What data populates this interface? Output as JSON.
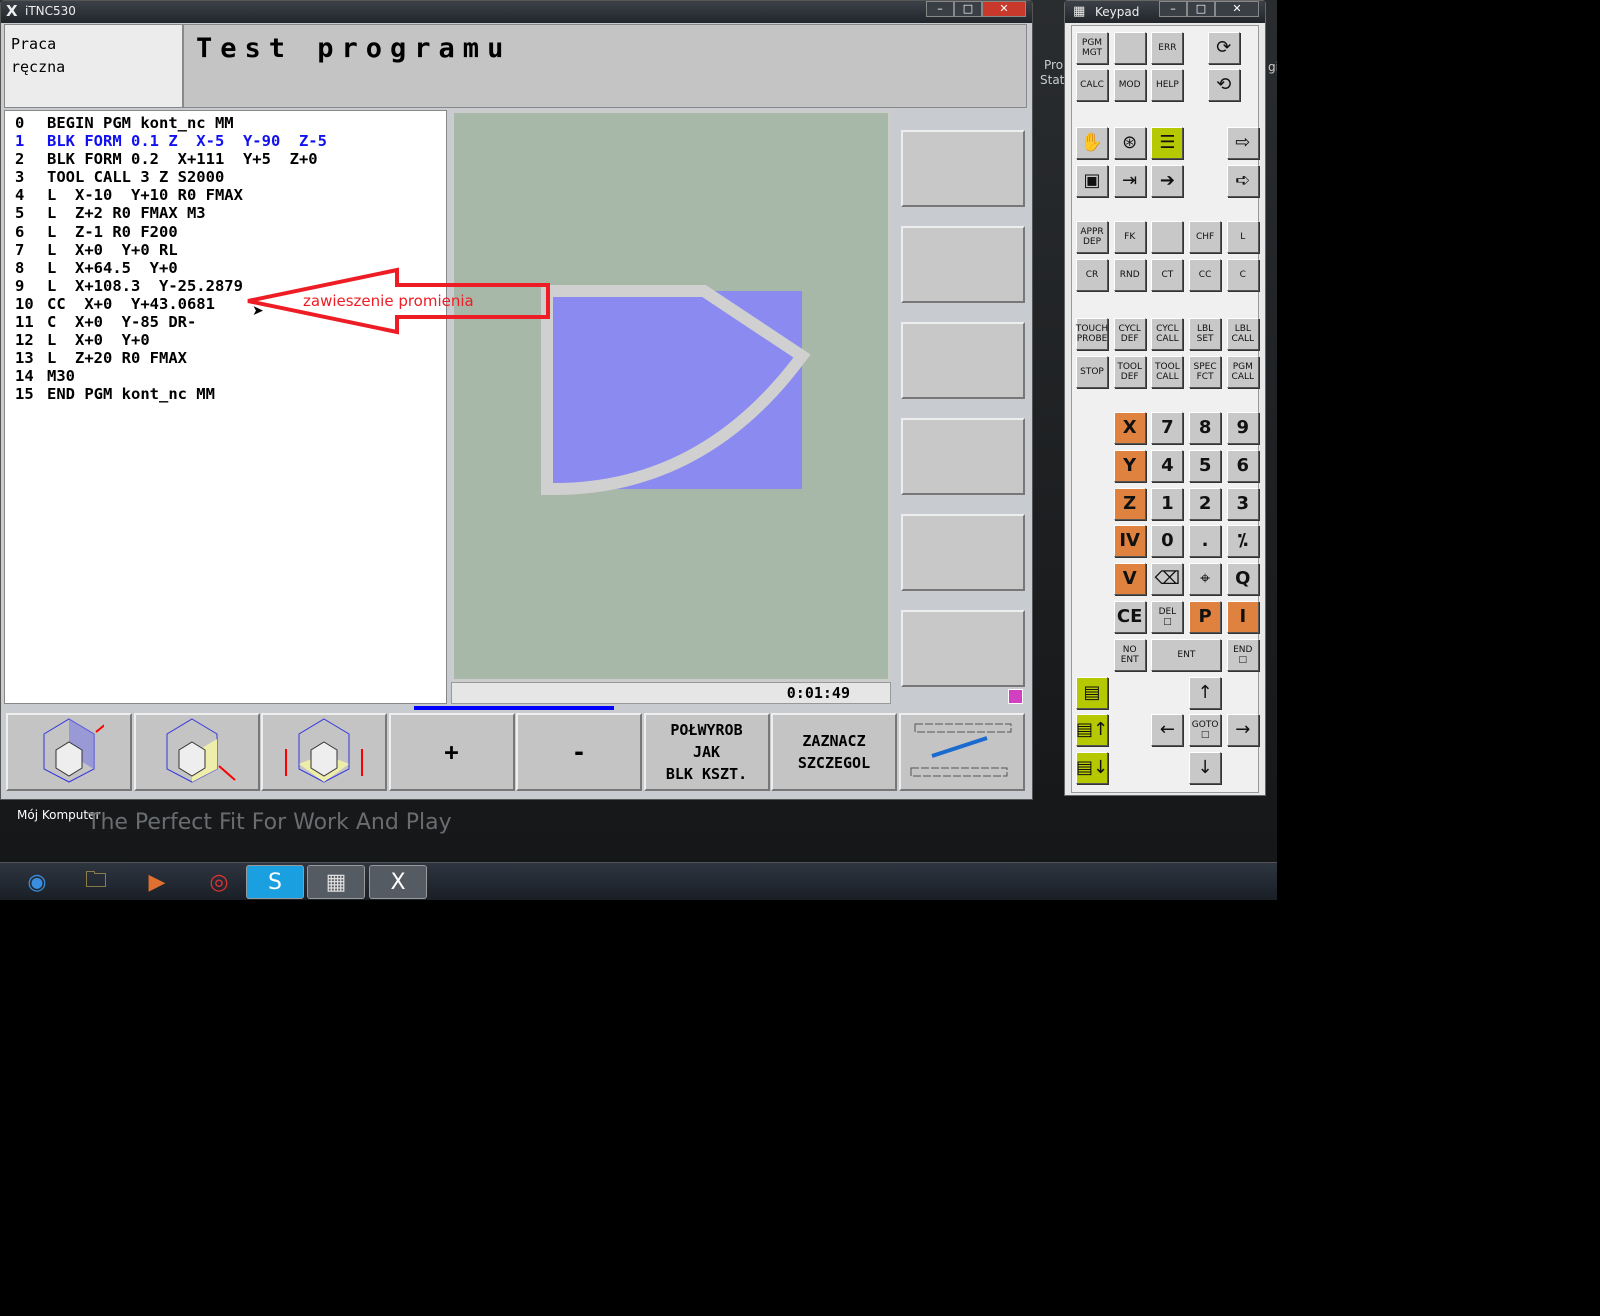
{
  "window": {
    "title": "iTNC530",
    "controls": [
      "–",
      "□",
      "✕"
    ]
  },
  "header": {
    "mode_line1": "Praca",
    "mode_line2": "ręczna",
    "title": "Test programu"
  },
  "program": {
    "lines": [
      {
        "n": "0",
        "text": "BEGIN PGM kont_nc MM",
        "highlight": false
      },
      {
        "n": "1",
        "text": "BLK FORM 0.1 Z  X-5  Y-90  Z-5",
        "highlight": true
      },
      {
        "n": "2",
        "text": "BLK FORM 0.2  X+111  Y+5  Z+0",
        "highlight": false
      },
      {
        "n": "3",
        "text": "TOOL CALL 3 Z S2000",
        "highlight": false
      },
      {
        "n": "4",
        "text": "L  X-10  Y+10 R0 FMAX",
        "highlight": false
      },
      {
        "n": "5",
        "text": "L  Z+2 R0 FMAX M3",
        "highlight": false
      },
      {
        "n": "6",
        "text": "L  Z-1 R0 F200",
        "highlight": false
      },
      {
        "n": "7",
        "text": "L  X+0  Y+0 RL",
        "highlight": false
      },
      {
        "n": "8",
        "text": "L  X+64.5  Y+0",
        "highlight": false
      },
      {
        "n": "9",
        "text": "L  X+108.3  Y-25.2879",
        "highlight": false
      },
      {
        "n": "10",
        "text": "CC  X+0  Y+43.0681",
        "highlight": false
      },
      {
        "n": "11",
        "text": "C  X+0  Y-85 DR-",
        "highlight": false
      },
      {
        "n": "12",
        "text": "L  X+0  Y+0",
        "highlight": false
      },
      {
        "n": "13",
        "text": "L  Z+20 R0 FMAX",
        "highlight": false
      },
      {
        "n": "14",
        "text": "M30",
        "highlight": false
      },
      {
        "n": "15",
        "text": "END PGM kont_nc MM",
        "highlight": false
      }
    ]
  },
  "annotation": {
    "text": "zawieszenie promienia",
    "color": "#ee1c24"
  },
  "graphic": {
    "workpiece_color": "#8a8af0",
    "background": "#a8b8a8",
    "contour_color": "#d0d0d0"
  },
  "time": "0:01:49",
  "softkeys": [
    {
      "icon": "view-3d-cube-icon"
    },
    {
      "icon": "view-3d-cube-yellow-icon"
    },
    {
      "icon": "view-3d-cube-arrows-icon"
    },
    {
      "label": "+"
    },
    {
      "label": "-"
    },
    {
      "label": "POŁWYROB\nJAK\nBLK KSZT."
    },
    {
      "label": "ZAZNACZ\nSZCZEGOL"
    },
    {
      "icon": "softkey-bar-switch-icon"
    }
  ],
  "desktop": {
    "icon_label": "Mój Komputer",
    "wallpaper_text": "The Perfect Fit For Work And Play",
    "fragment1": "Pro",
    "fragment2": "Stati",
    "fragment3": "gi"
  },
  "taskbar": [
    {
      "icon": "start-orb-icon",
      "glyph": "◉"
    },
    {
      "icon": "explorer-icon",
      "glyph": "🗀"
    },
    {
      "icon": "media-player-icon",
      "glyph": "▶"
    },
    {
      "icon": "chrome-icon",
      "glyph": "◎"
    },
    {
      "icon": "skype-icon",
      "glyph": "S"
    },
    {
      "icon": "keypad-app-icon",
      "glyph": "▦"
    },
    {
      "icon": "tnc-app-icon",
      "glyph": "X"
    }
  ],
  "keypad": {
    "title": "Keypad",
    "colors": {
      "orange": "#e0823f",
      "lime": "#b6c800",
      "gray": "#c8c8c8"
    },
    "rows": [
      [
        {
          "label": "PGM\nMGT"
        },
        {
          "label": ""
        },
        {
          "label": "ERR"
        },
        null,
        {
          "icon": "rotate-screen-icon",
          "glyph": "⟳",
          "shift": true
        }
      ],
      [
        {
          "label": "CALC"
        },
        {
          "label": "MOD"
        },
        {
          "label": "HELP"
        },
        null,
        {
          "icon": "rotate-screen-alt-icon",
          "glyph": "⟲",
          "shift": true
        }
      ],
      [
        {
          "icon": "manual-hand-icon",
          "glyph": "✋"
        },
        {
          "icon": "handwheel-icon",
          "glyph": "⊛"
        },
        {
          "icon": "program-run-icon",
          "glyph": "☰",
          "color": "lime"
        },
        null,
        {
          "icon": "program-edit-icon",
          "glyph": "⇨"
        }
      ],
      [
        {
          "icon": "single-block-icon",
          "glyph": "▣"
        },
        {
          "icon": "full-sequence-icon",
          "glyph": "⇥"
        },
        {
          "icon": "positioning-mdi-icon",
          "glyph": "➔"
        },
        null,
        {
          "icon": "test-run-icon",
          "glyph": "➪"
        }
      ],
      [
        {
          "label": "APPR\nDEP"
        },
        {
          "label": "FK"
        },
        {
          "label": ""
        },
        {
          "label": "CHF"
        },
        {
          "label": "L"
        }
      ],
      [
        {
          "label": "CR"
        },
        {
          "label": "RND"
        },
        {
          "label": "CT"
        },
        {
          "label": "CC"
        },
        {
          "label": "C"
        }
      ],
      [
        {
          "label": "TOUCH\nPROBE"
        },
        {
          "label": "CYCL\nDEF"
        },
        {
          "label": "CYCL\nCALL"
        },
        {
          "label": "LBL\nSET"
        },
        {
          "label": "LBL\nCALL"
        }
      ],
      [
        {
          "label": "STOP"
        },
        {
          "label": "TOOL\nDEF"
        },
        {
          "label": "TOOL\nCALL"
        },
        {
          "label": "SPEC\nFCT"
        },
        {
          "label": "PGM\nCALL"
        }
      ],
      [
        null,
        {
          "label": "X",
          "color": "orange",
          "big": true
        },
        {
          "label": "7",
          "big": true
        },
        {
          "label": "8",
          "big": true
        },
        {
          "label": "9",
          "big": true
        }
      ],
      [
        null,
        {
          "label": "Y",
          "color": "orange",
          "big": true
        },
        {
          "label": "4",
          "big": true
        },
        {
          "label": "5",
          "big": true
        },
        {
          "label": "6",
          "big": true
        }
      ],
      [
        null,
        {
          "label": "Z",
          "color": "orange",
          "big": true
        },
        {
          "label": "1",
          "big": true
        },
        {
          "label": "2",
          "big": true
        },
        {
          "label": "3",
          "big": true
        }
      ],
      [
        null,
        {
          "label": "IV",
          "color": "orange",
          "big": true
        },
        {
          "label": "0",
          "big": true
        },
        {
          "label": ".",
          "big": true
        },
        {
          "label": "⁒",
          "big": true
        }
      ],
      [
        null,
        {
          "label": "V",
          "color": "orange",
          "big": true
        },
        {
          "icon": "backspace-icon",
          "glyph": "⌫"
        },
        {
          "icon": "actual-position-icon",
          "glyph": "⌖"
        },
        {
          "label": "Q",
          "big": true
        }
      ],
      [
        null,
        {
          "label": "CE",
          "big": true
        },
        {
          "label": "DEL\n□"
        },
        {
          "label": "P",
          "color": "orange",
          "big": true
        },
        {
          "label": "I",
          "color": "orange",
          "big": true
        }
      ],
      [
        null,
        {
          "label": "NO\nENT"
        },
        {
          "label": "ENT",
          "wide": true
        },
        null,
        {
          "label": "END\n□"
        }
      ],
      [
        {
          "icon": "screen-layout-icon",
          "glyph": "▤",
          "color": "lime"
        },
        null,
        null,
        {
          "icon": "arrow-up-icon",
          "glyph": "↑"
        },
        null
      ],
      [
        {
          "icon": "page-up-icon",
          "glyph": "▤↑",
          "color": "lime"
        },
        null,
        {
          "icon": "arrow-left-icon",
          "glyph": "←"
        },
        {
          "label": "GOTO\n□"
        },
        {
          "icon": "arrow-right-icon",
          "glyph": "→"
        }
      ],
      [
        {
          "icon": "page-down-icon",
          "glyph": "▤↓",
          "color": "lime"
        },
        null,
        null,
        {
          "icon": "arrow-down-icon",
          "glyph": "↓"
        },
        null
      ]
    ]
  }
}
